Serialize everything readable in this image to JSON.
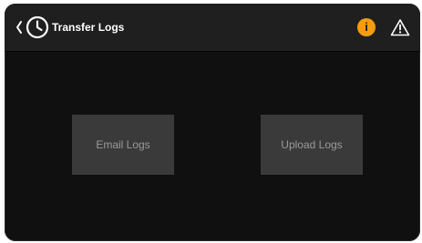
{
  "header": {
    "title": "Transfer Logs",
    "info_glyph": "i",
    "back_icon": "chevron-left-icon",
    "history_icon": "clock-icon",
    "warning_icon": "warning-triangle-icon",
    "accent_color": "#f39c12"
  },
  "actions": {
    "email_label": "Email Logs",
    "upload_label": "Upload Logs"
  }
}
